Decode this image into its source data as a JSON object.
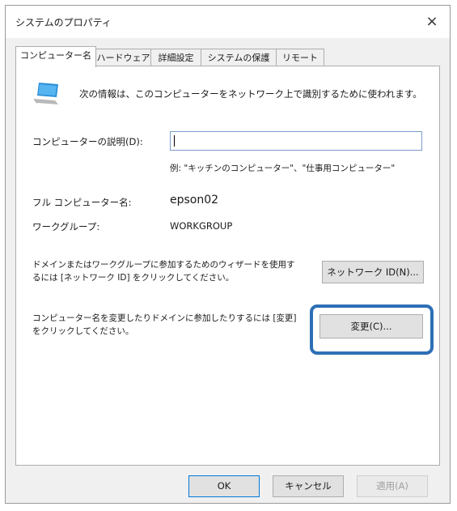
{
  "window": {
    "title": "システムのプロパティ",
    "close_glyph": "×"
  },
  "tabs": [
    {
      "label": "コンピューター名"
    },
    {
      "label": "ハードウェア"
    },
    {
      "label": "詳細設定"
    },
    {
      "label": "システムの保護"
    },
    {
      "label": "リモート"
    }
  ],
  "panel": {
    "intro": "次の情報は、このコンピューターをネットワーク上で識別するために使われます。",
    "description_label": "コンピューターの説明(D):",
    "description_value": "",
    "description_example": "例: \"キッチンのコンピューター\"、\"仕事用コンピューター\"",
    "full_name_label": "フル コンピューター名:",
    "full_name_value": "epson02",
    "workgroup_label": "ワークグループ:",
    "workgroup_value": "WORKGROUP",
    "network_text_1": "ドメインまたはワークグループに参加するためのウィザードを使用す",
    "network_text_2": "るには [ネットワーク ID] をクリックしてください。",
    "network_button": "ネットワーク ID(N)...",
    "change_text_1": "コンピューター名を変更したりドメインに参加したりするには [変更]",
    "change_text_2": "をクリックしてください。",
    "change_button": "変更(C)..."
  },
  "buttons": {
    "ok": "OK",
    "cancel": "キャンセル",
    "apply": "適用(A)"
  },
  "colors": {
    "highlight": "#2d6fb6",
    "icon": "monitor-icon"
  }
}
